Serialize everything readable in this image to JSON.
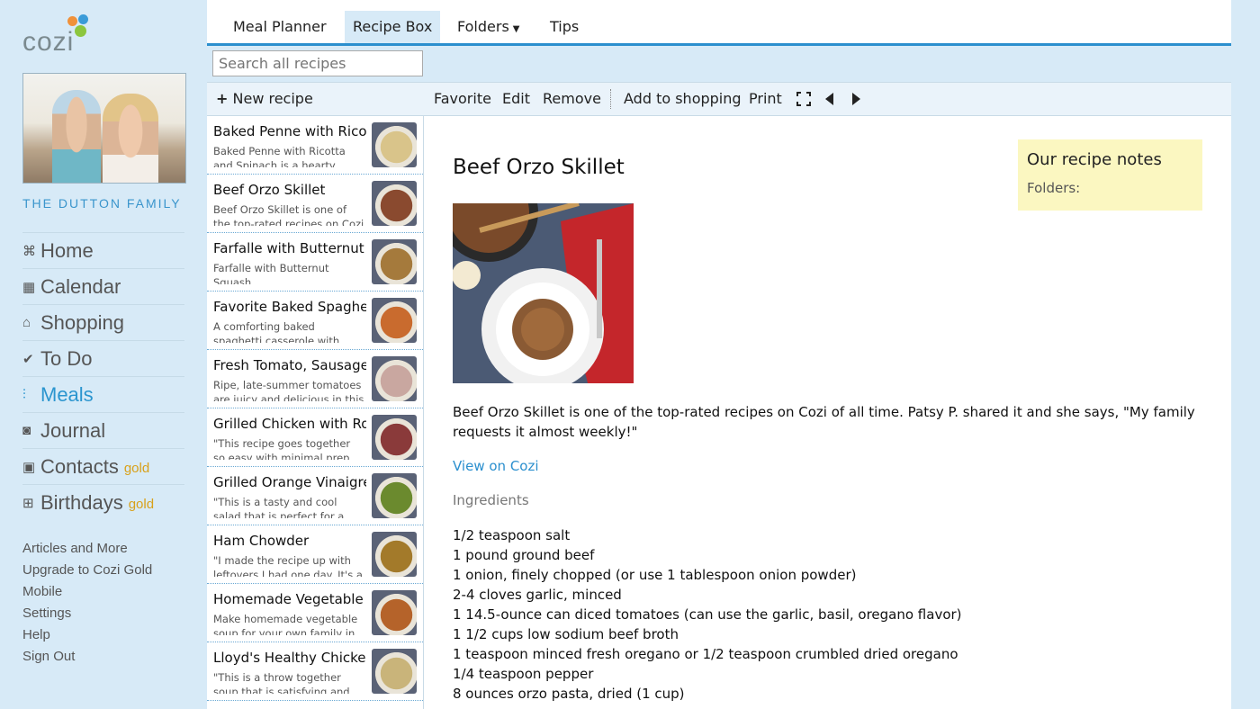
{
  "brand": {
    "logo_text": "cozi",
    "family_name": "THE DUTTON FAMILY"
  },
  "nav": [
    {
      "label": "Home",
      "icon": "home-icon",
      "active": false,
      "gold": ""
    },
    {
      "label": "Calendar",
      "icon": "calendar-icon",
      "active": false,
      "gold": ""
    },
    {
      "label": "Shopping",
      "icon": "cart-icon",
      "active": false,
      "gold": ""
    },
    {
      "label": "To Do",
      "icon": "check-icon",
      "active": false,
      "gold": ""
    },
    {
      "label": "Meals",
      "icon": "utensils-icon",
      "active": true,
      "gold": ""
    },
    {
      "label": "Journal",
      "icon": "camera-icon",
      "active": false,
      "gold": ""
    },
    {
      "label": "Contacts",
      "icon": "contacts-icon",
      "active": false,
      "gold": "gold"
    },
    {
      "label": "Birthdays",
      "icon": "gift-icon",
      "active": false,
      "gold": "gold"
    }
  ],
  "links": [
    "Articles and More",
    "Upgrade to Cozi Gold",
    "Mobile",
    "Settings",
    "Help",
    "Sign Out"
  ],
  "tabs": [
    {
      "label": "Meal Planner",
      "active": false
    },
    {
      "label": "Recipe Box",
      "active": true
    },
    {
      "label": "Folders",
      "active": false
    },
    {
      "label": "Tips",
      "active": false
    }
  ],
  "search": {
    "placeholder": "Search all recipes"
  },
  "list": {
    "new_label": "New recipe",
    "items": [
      {
        "title": "Baked Penne with Ricotta and Spinach",
        "desc": "Baked Penne with Ricotta and Spinach is a hearty",
        "color": "#d9c48a"
      },
      {
        "title": "Beef Orzo Skillet",
        "desc": "Beef Orzo Skillet is one of the top-rated recipes on Cozi of",
        "color": "#8a4a2f"
      },
      {
        "title": "Farfalle with Butternut Squash",
        "desc": "Farfalle with Butternut Squash",
        "color": "#a57a3c"
      },
      {
        "title": "Favorite Baked Spaghetti",
        "desc": "A comforting baked spaghetti casserole with plenty of",
        "color": "#c96b2e"
      },
      {
        "title": "Fresh Tomato, Sausage and Pasta",
        "desc": "Ripe, late-summer tomatoes are juicy and delicious in this",
        "color": "#c9a7a0"
      },
      {
        "title": "Grilled Chicken with Roasted Vegetables",
        "desc": "\"This recipe goes together so easy with minimal prep",
        "color": "#8a3a3a"
      },
      {
        "title": "Grilled Orange Vinaigrette Salad",
        "desc": "\"This is a tasty and cool salad that is perfect for a summer",
        "color": "#6b8a2e"
      },
      {
        "title": "Ham Chowder",
        "desc": "\"I made the recipe up with leftovers I had one day. It's a",
        "color": "#a37a2a"
      },
      {
        "title": "Homemade Vegetable Soup",
        "desc": "Make homemade vegetable soup for your own family in",
        "color": "#b5632a"
      },
      {
        "title": "Lloyd's Healthy Chicken Soup",
        "desc": "\"This is a throw together soup that is satisfying and",
        "color": "#c9b47a"
      }
    ]
  },
  "toolbar": {
    "favorite": "Favorite",
    "edit": "Edit",
    "remove": "Remove",
    "add_shopping": "Add to shopping",
    "print": "Print"
  },
  "detail": {
    "title": "Beef Orzo Skillet",
    "description": "Beef Orzo Skillet is one of the top-rated recipes on Cozi of all time. Patsy P. shared it and she says, \"My family requests it almost weekly!\"",
    "link": "View on Cozi",
    "ingredients_label": "Ingredients",
    "ingredients": [
      "1/2 teaspoon salt",
      "1 pound ground beef",
      "1 onion, finely chopped (or use 1 tablespoon onion powder)",
      "2-4 cloves garlic, minced",
      "1 14.5-ounce can diced tomatoes (can use the garlic, basil, oregano flavor)",
      "1 1/2 cups low sodium beef broth",
      "1 teaspoon minced fresh oregano or 1/2 teaspoon crumbled dried oregano",
      "1/4 teaspoon pepper",
      "8 ounces orzo pasta, dried (1 cup)"
    ]
  },
  "notes": {
    "title": "Our recipe notes",
    "folders": "Folders:"
  },
  "colors": {
    "accent": "#2b8fce",
    "sidebar_bg": "#d7eaf7",
    "gold": "#d8a11a",
    "notes_bg": "#fbf7c1"
  }
}
